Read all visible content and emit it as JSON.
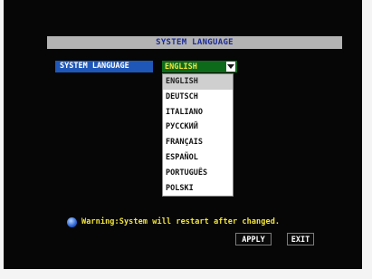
{
  "title_bar": {
    "title": "SYSTEM LANGUAGE"
  },
  "setting": {
    "label": "SYSTEM LANGUAGE",
    "selected_value": "ENGLISH"
  },
  "dropdown": {
    "options": [
      "ENGLISH",
      "DEUTSCH",
      "ITALIANO",
      "РУССКИЙ",
      "FRANÇAIS",
      "ESPAÑOL",
      "PORTUGUÊS",
      "POLSKI"
    ],
    "highlighted_index": 0
  },
  "warning": {
    "text": "Warning:System will restart after changed.",
    "icon": "info-globe-icon"
  },
  "buttons": {
    "apply": "APPLY",
    "exit": "EXIT"
  },
  "colors": {
    "background": "#060606",
    "title_bar": "#b3b3b3",
    "title_text": "#1b2b9a",
    "label_bg": "#1f57b8",
    "select_bg": "#0d6a1a",
    "select_text": "#f3e53a",
    "warning_text": "#f3e53a"
  }
}
